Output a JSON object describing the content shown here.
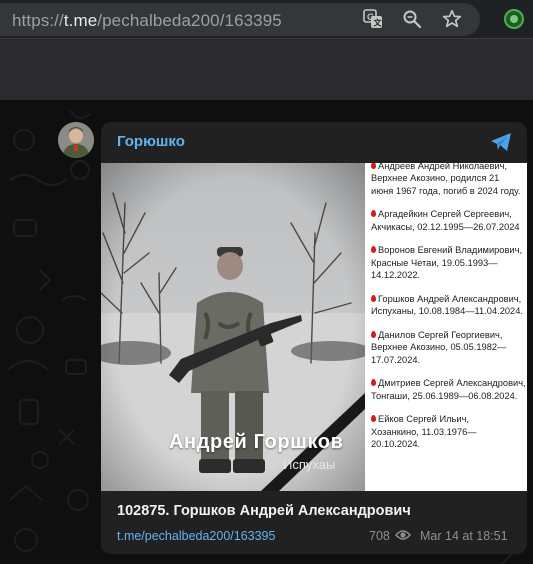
{
  "browser": {
    "url_prefix": "https://",
    "url_host": "t.me",
    "url_path": "/pechalbeda200/163395",
    "icons": [
      "translate-icon",
      "zoom-icon",
      "bookmark-star-icon",
      "extension-icon"
    ]
  },
  "post": {
    "channel_name": "Горюшко",
    "image": {
      "overlay_name": "Андрей Горшков",
      "overlay_place": "Испухаы"
    },
    "list_entries": [
      {
        "name": "Андреев Андрей Николаевич,",
        "rest": "Верхнее Акозино, родился 21 июня 1967 года, погиб в 2024 году."
      },
      {
        "name": "Аргадейкин Сергей Сергеевич,",
        "rest": "Акчикасы, 02.12.1995—26.07.2024"
      },
      {
        "name": "Воронов Евгений Владимирович,",
        "rest": "Красные Четаи, 19.05.1993—14.12.2022."
      },
      {
        "name": "Горшков Андрей Александрович,",
        "rest": "Испуханы, 10.08.1984—11.04.2024."
      },
      {
        "name": "Данилов Сергей Георгиевич,",
        "rest": "Верхнее Акозино, 05.05.1982—17.07.2024."
      },
      {
        "name": "Дмитриев Сергей Александрович,",
        "rest": "Тонгаши, 25.06.1989—06.08.2024."
      },
      {
        "name": "Ейков Сергей Ильич,",
        "rest": "Хозанкино, 11.03.1976—20.10.2024."
      }
    ],
    "caption": "102875. Горшков Андрей Александрович",
    "link": "t.me/pechalbeda200/163395",
    "views": "708",
    "timestamp": "Mar 14 at 18:51"
  },
  "colors": {
    "accent": "#62b3f2",
    "bubble": "#212121",
    "background": "#0f0f10",
    "drop": "#d11c1c"
  }
}
